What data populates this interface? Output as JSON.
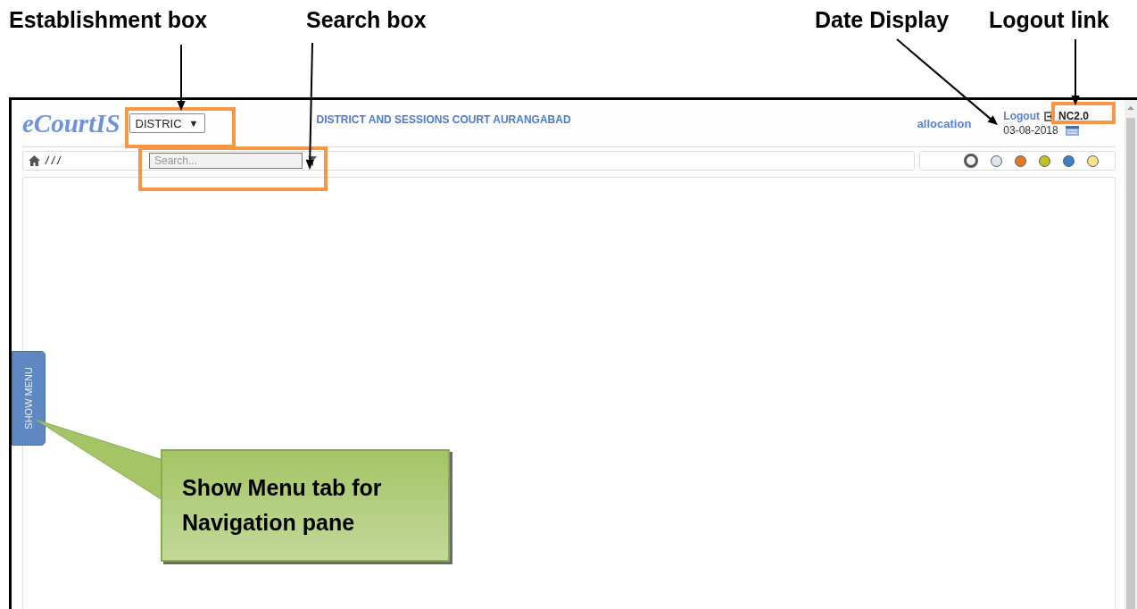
{
  "annotations": {
    "labels": [
      {
        "text": "Establishment box"
      },
      {
        "text": "Search box"
      },
      {
        "text": "Date Display"
      },
      {
        "text": "Logout link"
      }
    ],
    "callout": "Show Menu tab for Navigation pane"
  },
  "header": {
    "logo": "eCourtIS",
    "establishment": {
      "value": "DISTRIC",
      "caret": "▼"
    },
    "court_title": "DISTRICT AND SESSIONS COURT AURANGABAD",
    "module": "allocation",
    "logout": "Logout",
    "version": "NC2.0",
    "date": "03-08-2018"
  },
  "toolbar": {
    "breadcrumb": "/   /   /",
    "search": {
      "placeholder": "Search..."
    }
  },
  "themes": [
    {
      "color": "#f2f2f2",
      "selected": true
    },
    {
      "color": "#dde6ef",
      "selected": false
    },
    {
      "color": "#e07a2e",
      "selected": false
    },
    {
      "color": "#c2c21c",
      "selected": false
    },
    {
      "color": "#3e7fc0",
      "selected": false
    },
    {
      "color": "#fde38a",
      "selected": false
    }
  ],
  "side_tab": "SHOW MENU"
}
